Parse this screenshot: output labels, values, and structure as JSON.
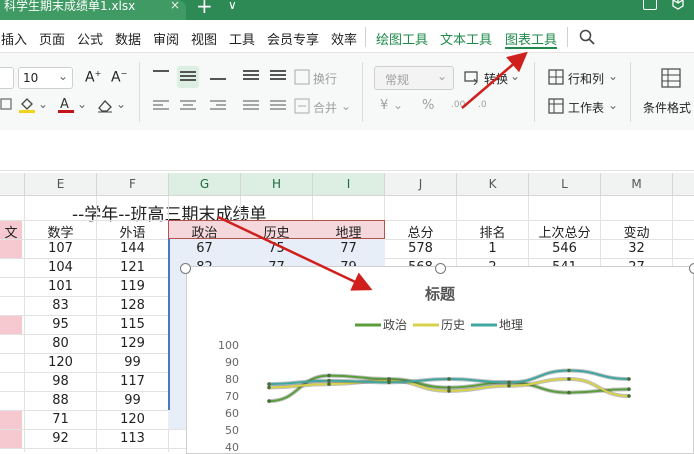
{
  "title_bar": {
    "file_tab": "科学生期末成绩单1.xlsx",
    "close": "×",
    "new_tab": "+",
    "new_tab_dropdown": "∨"
  },
  "menu": {
    "items": [
      "插入",
      "页面",
      "公式",
      "数据",
      "审阅",
      "视图",
      "工具",
      "会员专享",
      "效率"
    ],
    "tool_tabs": [
      "绘图工具",
      "文本工具",
      "图表工具"
    ]
  },
  "ribbon": {
    "font_size": "10",
    "number_format": "常规",
    "convert_label": "转换",
    "rows_cols_label": "行和列",
    "wrap_label": "换行",
    "merge_label": "合并",
    "worksheet_label": "工作表",
    "cond_format_label": "条件格式",
    "currency_symbol": "¥",
    "percent_symbol": "%"
  },
  "sheet": {
    "columns": [
      "E",
      "F",
      "G",
      "H",
      "I",
      "J",
      "K",
      "L",
      "M"
    ],
    "selected_columns": [
      "G",
      "H",
      "I"
    ],
    "title": "--学年--班高三期末成绩单",
    "headers": [
      "数学",
      "外语",
      "政治",
      "历史",
      "地理",
      "总分",
      "排名",
      "上次总分",
      "变动"
    ],
    "left_partial_header": "文",
    "rows": [
      [
        "107",
        "144",
        "67",
        "75",
        "77",
        "578",
        "1",
        "546",
        "32"
      ],
      [
        "104",
        "121",
        "82",
        "77",
        "79",
        "568",
        "2",
        "541",
        "27"
      ],
      [
        "101",
        "119"
      ],
      [
        "83",
        "128"
      ],
      [
        "95",
        "115"
      ],
      [
        "80",
        "129"
      ],
      [
        "120",
        "99"
      ],
      [
        "98",
        "117"
      ],
      [
        "88",
        "99"
      ],
      [
        "71",
        "120"
      ],
      [
        "92",
        "113"
      ]
    ]
  },
  "chart": {
    "title": "标题",
    "series_colors": [
      "#5a9e3c",
      "#d6d24a",
      "#3fa7a0"
    ]
  },
  "chart_data": {
    "type": "line",
    "title": "标题",
    "xlabel": "",
    "ylabel": "",
    "ylim": [
      40,
      100
    ],
    "yticks": [
      "100",
      "90",
      "80",
      "70",
      "60",
      "50",
      "40"
    ],
    "grid": false,
    "legend_position": "top",
    "series": [
      {
        "name": "政治",
        "values": [
          67,
          82,
          80,
          75,
          78,
          72,
          74
        ]
      },
      {
        "name": "历史",
        "values": [
          75,
          77,
          79,
          73,
          76,
          80,
          70
        ]
      },
      {
        "name": "地理",
        "values": [
          77,
          79,
          78,
          80,
          78,
          85,
          80
        ]
      }
    ]
  }
}
